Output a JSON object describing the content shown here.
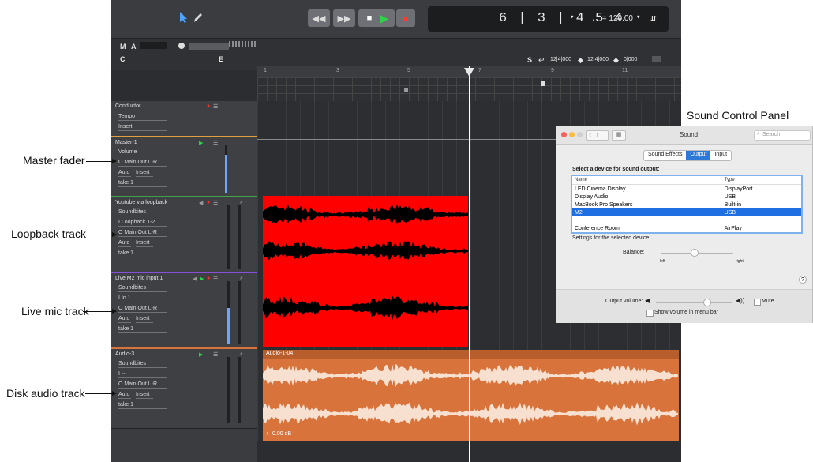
{
  "annotations": {
    "panel_title": "Sound Control Panel",
    "master_fader": "Master fader",
    "loopback_track": "Loopback track",
    "live_mic_track": "Live mic track",
    "disk_audio_track": "Disk audio track"
  },
  "transport": {
    "position": "6 | 3 | 4 5 4",
    "tempo": "♩ = 120.00",
    "dropdown_arrow": "▾",
    "rewind": "◀◀",
    "forward": "▶▶",
    "stop": "■",
    "play": "▶",
    "record": "●"
  },
  "toolbar": {
    "m": "M",
    "a": "A",
    "c": "C",
    "e": "E",
    "s": "S",
    "loop_start": "12|4|000",
    "loop_end": "12|4|000",
    "punch": "0|000"
  },
  "ruler": [
    "1",
    "3",
    "5",
    "7",
    "9",
    "11"
  ],
  "tracks": [
    {
      "name": "Conductor",
      "rows": [
        "Tempo",
        "Insert"
      ]
    },
    {
      "name": "Master-1",
      "rows": [
        "Volume",
        "O Main Out L-R",
        "Auto",
        "Insert",
        "take 1"
      ]
    },
    {
      "name": "Youtube via loopback",
      "rows": [
        "Soundbites",
        "I Loopback 1-2",
        "O Main Out L-R",
        "Auto",
        "Insert",
        "take 1"
      ]
    },
    {
      "name": "Live M2 mic input 1",
      "rows": [
        "Soundbites",
        "I In 1",
        "O Main Out L-R",
        "Auto",
        "Insert",
        "take 1"
      ]
    },
    {
      "name": "Audio-3",
      "rows": [
        "Soundbites",
        "I --",
        "O Main Out L-R",
        "Auto",
        "Insert",
        "take 1"
      ]
    }
  ],
  "regions": {
    "audio_name": "Audio-1-04",
    "gain": "0.00 dB"
  },
  "sound_panel": {
    "title": "Sound",
    "search_placeholder": "Search",
    "tabs": [
      "Sound Effects",
      "Output",
      "Input"
    ],
    "heading": "Select a device for sound output:",
    "columns": [
      "Name",
      "Type"
    ],
    "devices": [
      {
        "name": "LED Cinema Display",
        "type": "DisplayPort"
      },
      {
        "name": "Display Audio",
        "type": "USB"
      },
      {
        "name": "MacBook Pro Speakers",
        "type": "Built-in"
      },
      {
        "name": "M2",
        "type": "USB",
        "selected": true
      },
      {
        "name": "",
        "type": ""
      },
      {
        "name": "Conference Room",
        "type": "AirPlay"
      }
    ],
    "settings_label": "Settings for the selected device:",
    "balance_label": "Balance:",
    "left_label": "left",
    "right_label": "right",
    "help": "?",
    "output_volume_label": "Output volume:",
    "output_volume": 0.68,
    "mute_label": "Mute",
    "show_volume_label": "Show volume in menu bar"
  },
  "colors": {
    "red_region": "#ff0000",
    "orange_region": "#d9733c",
    "accent_blue": "#1f6fe2"
  }
}
